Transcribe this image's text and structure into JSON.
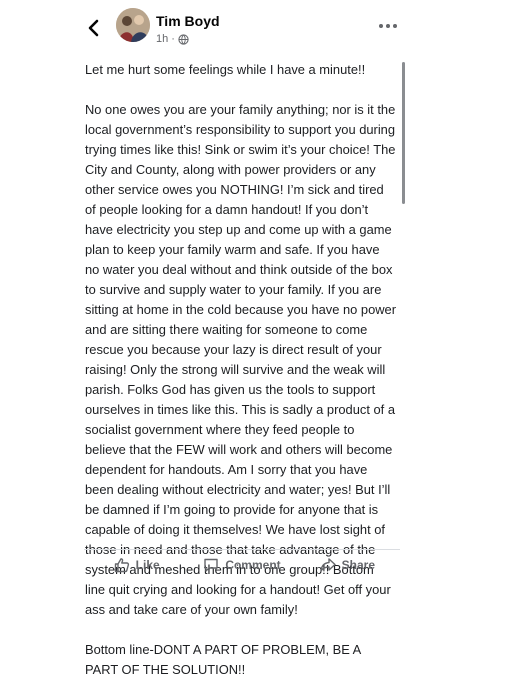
{
  "post": {
    "author": "Tim Boyd",
    "time": "1h",
    "time_separator": "·",
    "paragraphs": [
      "Let me hurt some feelings while I have a minute!!",
      "No one owes you are your family anything; nor is it the local government’s responsibility to support you during trying times like this! Sink or swim it’s your choice!  The City and County, along with power providers or any other service owes you NOTHING!  I’m sick and tired of people looking for a damn handout!  If you don’t have electricity you step up and come up with a game plan to keep your family warm and safe. If you have no water you deal without and think outside of the box to survive and supply water to your family. If you are sitting at home in the cold because you have no power and are sitting there waiting for someone to come rescue you because your lazy is direct result of your raising!  Only the strong will survive and the weak will parish. Folks God has given us the tools to support ourselves in times like this. This is sadly a product of a socialist government where they feed people to believe that the FEW will work and others will become dependent for handouts. Am I sorry that you have been dealing without electricity and water; yes! But I’ll be damned if I’m going to provide for anyone that is capable of doing it themselves!  We have lost sight of those in need and those that take advantage of the system and meshed them in to one group!! Bottom line quit crying and looking for a handout! Get off your ass and take care of your own family!",
      "Bottom line-DONT A PART OF PROBLEM, BE A PART OF THE SOLUTION!!"
    ]
  },
  "actions": {
    "like": "Like",
    "comment": "Comment",
    "share": "Share"
  },
  "icons": {
    "back": "back-arrow-icon",
    "privacy": "globe-icon",
    "more": "more-options-icon",
    "like": "thumbs-up-icon",
    "comment": "comment-bubble-icon",
    "share": "share-arrow-icon"
  }
}
